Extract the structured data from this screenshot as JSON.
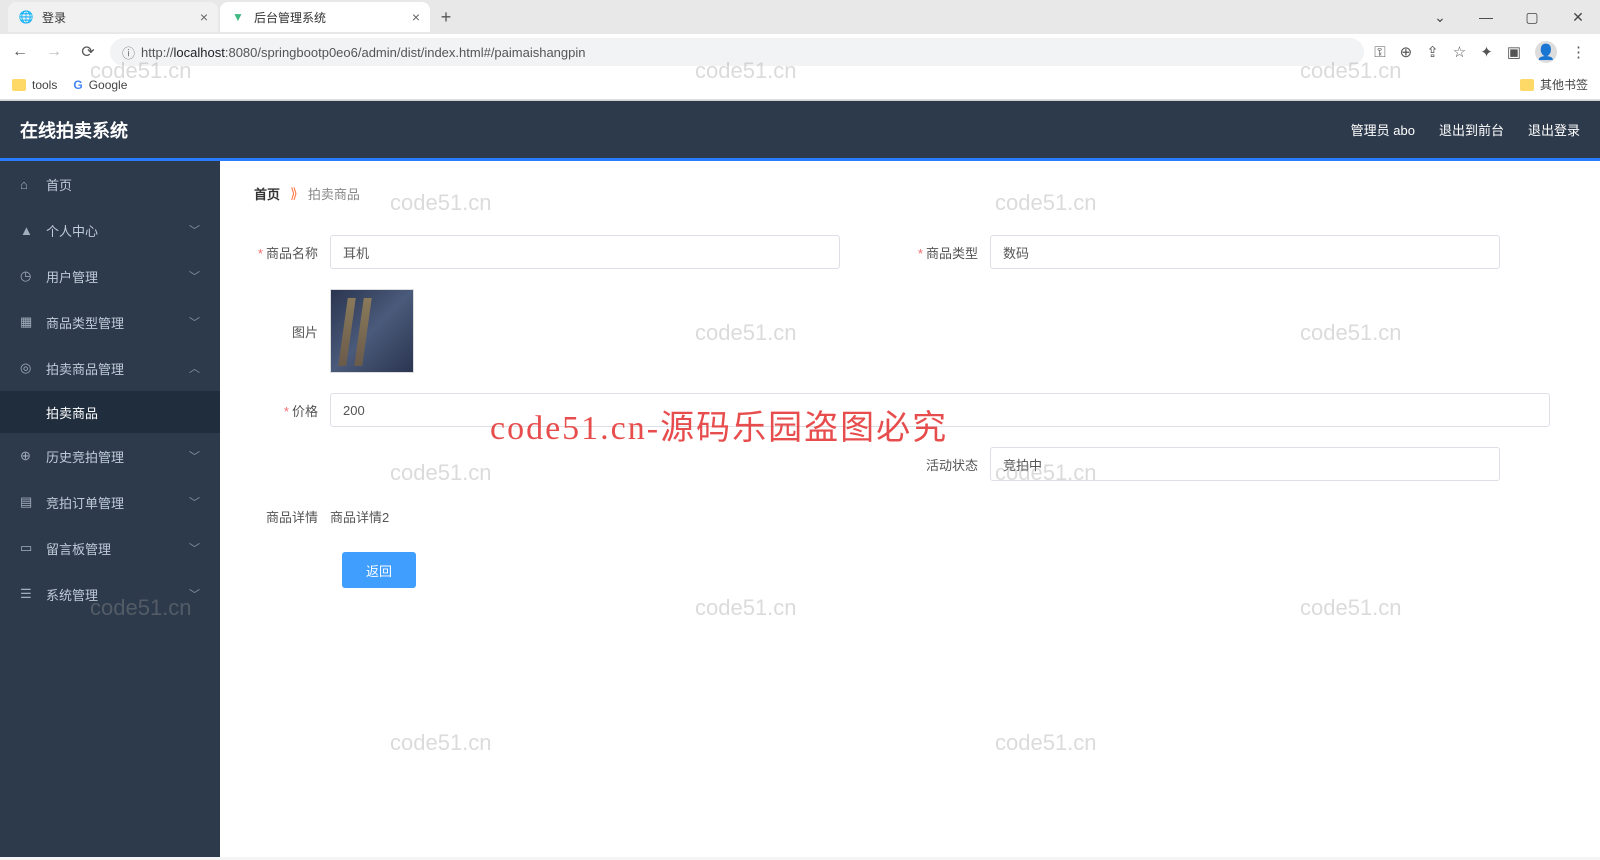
{
  "browser": {
    "tabs": [
      {
        "title": "登录",
        "active": false
      },
      {
        "title": "后台管理系统",
        "active": true
      }
    ],
    "url_prefix": "http://",
    "url_host": "localhost",
    "url_path": ":8080/springbootp0eo6/admin/dist/index.html#/paimaishangpin",
    "bookmarks": {
      "tools": "tools",
      "google": "Google",
      "other": "其他书签"
    }
  },
  "header": {
    "title": "在线拍卖系统",
    "admin": "管理员 abo",
    "front": "退出到前台",
    "logout": "退出登录"
  },
  "sidebar": {
    "items": [
      {
        "label": "首页",
        "icon": "home",
        "expandable": false
      },
      {
        "label": "个人中心",
        "icon": "user",
        "expandable": true
      },
      {
        "label": "用户管理",
        "icon": "clock",
        "expandable": true
      },
      {
        "label": "商品类型管理",
        "icon": "grid",
        "expandable": true
      },
      {
        "label": "拍卖商品管理",
        "icon": "target",
        "expandable": true,
        "expanded": true
      },
      {
        "label": "历史竞拍管理",
        "icon": "history",
        "expandable": true
      },
      {
        "label": "竞拍订单管理",
        "icon": "order",
        "expandable": true
      },
      {
        "label": "留言板管理",
        "icon": "message",
        "expandable": true
      },
      {
        "label": "系统管理",
        "icon": "settings",
        "expandable": true
      }
    ],
    "sub_paimai": "拍卖商品"
  },
  "breadcrumb": {
    "home": "首页",
    "current": "拍卖商品"
  },
  "form": {
    "name_label": "商品名称",
    "name_value": "耳机",
    "type_label": "商品类型",
    "type_value": "数码",
    "pic_label": "图片",
    "price_label": "价格",
    "price_value": "200",
    "status_label": "活动状态",
    "status_value": "竞拍中",
    "detail_label": "商品详情",
    "detail_value": "商品详情2",
    "back_btn": "返回"
  },
  "watermark": {
    "text": "code51.cn",
    "big": "code51.cn-源码乐园盗图必究"
  }
}
